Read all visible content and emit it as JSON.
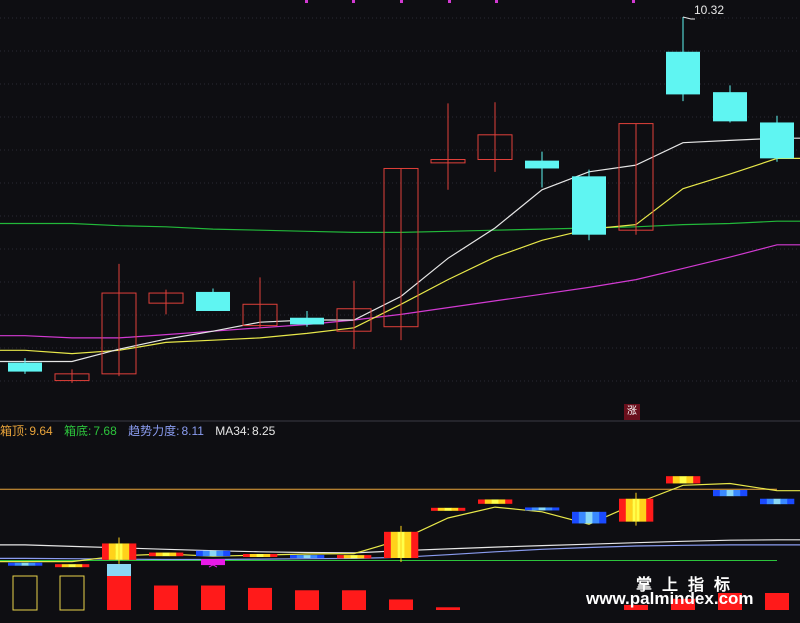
{
  "upper_labels": {
    "high_price": "10.32",
    "zhang_badge": "涨"
  },
  "legend": {
    "box_top_label": "箱顶:",
    "box_top_value": "9.64",
    "box_bottom_label": "箱底:",
    "box_bottom_value": "7.68",
    "trend_label": "趋势力度:",
    "trend_value": "8.11",
    "ma34_label": "MA34:",
    "ma34_value": "8.25"
  },
  "watermark": {
    "line1": "掌上指标",
    "line2": "www.palmindex.com"
  },
  "colors": {
    "background": "#0e0e12",
    "up": "#e0403a",
    "down": "#5ff5f2",
    "ma_white": "#e6e6e6",
    "ma_yellow": "#e8e84a",
    "ma_green": "#22b83a",
    "ma_magenta": "#d23ad2",
    "box_top": "#e8a33a",
    "box_bottom": "#2cc43c",
    "trend": "#8a9cf0",
    "ma34": "#e6e6e6"
  },
  "chart_data": [
    {
      "type": "candlestick",
      "ylim": [
        6.8,
        10.4
      ],
      "candles": [
        {
          "o": 7.24,
          "h": 7.28,
          "l": 7.14,
          "c": 7.16
        },
        {
          "o": 7.08,
          "h": 7.18,
          "l": 7.06,
          "c": 7.14
        },
        {
          "o": 7.14,
          "h": 8.12,
          "l": 7.12,
          "c": 7.86
        },
        {
          "o": 7.77,
          "h": 7.89,
          "l": 7.67,
          "c": 7.86
        },
        {
          "o": 7.87,
          "h": 7.9,
          "l": 7.7,
          "c": 7.7
        },
        {
          "o": 7.57,
          "h": 8.0,
          "l": 7.55,
          "c": 7.76
        },
        {
          "o": 7.64,
          "h": 7.7,
          "l": 7.56,
          "c": 7.58
        },
        {
          "o": 7.52,
          "h": 7.97,
          "l": 7.36,
          "c": 7.72
        },
        {
          "o": 7.56,
          "h": 8.97,
          "l": 7.44,
          "c": 8.97
        },
        {
          "o": 9.02,
          "h": 9.55,
          "l": 8.78,
          "c": 9.05
        },
        {
          "o": 9.05,
          "h": 9.56,
          "l": 8.94,
          "c": 9.27
        },
        {
          "o": 9.04,
          "h": 9.12,
          "l": 8.8,
          "c": 8.97
        },
        {
          "o": 8.9,
          "h": 8.96,
          "l": 8.33,
          "c": 8.38
        },
        {
          "o": 8.42,
          "h": 9.37,
          "l": 8.38,
          "c": 9.37
        },
        {
          "o": 10.01,
          "h": 10.32,
          "l": 9.57,
          "c": 9.63
        },
        {
          "o": 9.65,
          "h": 9.71,
          "l": 9.38,
          "c": 9.39
        },
        {
          "o": 9.38,
          "h": 9.44,
          "l": 9.03,
          "c": 9.06
        }
      ],
      "ma_white": [
        7.25,
        7.25,
        7.36,
        7.45,
        7.52,
        7.6,
        7.62,
        7.62,
        7.83,
        8.17,
        8.44,
        8.78,
        8.94,
        9.0,
        9.2,
        9.22,
        9.24
      ],
      "ma_yellow": [
        7.35,
        7.32,
        7.35,
        7.42,
        7.44,
        7.46,
        7.5,
        7.55,
        7.76,
        7.98,
        8.18,
        8.33,
        8.43,
        8.47,
        8.79,
        8.92,
        9.06
      ],
      "ma_green": [
        8.48,
        8.48,
        8.46,
        8.45,
        8.43,
        8.42,
        8.41,
        8.4,
        8.4,
        8.41,
        8.42,
        8.43,
        8.44,
        8.45,
        8.47,
        8.48,
        8.5
      ],
      "ma_magenta": [
        7.48,
        7.46,
        7.46,
        7.49,
        7.52,
        7.55,
        7.58,
        7.62,
        7.67,
        7.73,
        7.79,
        7.85,
        7.91,
        7.98,
        8.08,
        8.18,
        8.29
      ]
    },
    {
      "type": "indicator",
      "ylim": [
        7.2,
        10.5
      ],
      "box_top": 9.64,
      "box_bottom": 7.68,
      "trend_line": [
        7.65,
        7.65,
        7.81,
        7.86,
        7.8,
        7.83,
        7.86,
        7.87,
        8.25,
        8.85,
        9.15,
        9.02,
        8.68,
        9.25,
        9.75,
        9.8,
        9.6
      ],
      "ma34_line": [
        8.11,
        8.07,
        8.03,
        7.99,
        7.95,
        7.92,
        7.9,
        7.89,
        7.95,
        8.0,
        8.05,
        8.09,
        8.13,
        8.17,
        8.21,
        8.24,
        8.25
      ],
      "trend_strength": [
        7.74,
        7.73,
        7.72,
        7.71,
        7.71,
        7.72,
        7.73,
        7.74,
        7.77,
        7.84,
        7.92,
        7.99,
        8.04,
        8.08,
        8.1,
        8.11,
        8.11
      ],
      "bars": [
        {
          "o": 7.62,
          "c": 7.58,
          "state": "weak-down"
        },
        {
          "o": 7.58,
          "c": 7.55,
          "state": "weak-up"
        },
        {
          "o": 8.15,
          "c": 7.7,
          "state": "strong-up"
        },
        {
          "o": 7.9,
          "c": 7.8,
          "state": "up"
        },
        {
          "o": 7.95,
          "c": 7.8,
          "state": "down"
        },
        {
          "o": 7.86,
          "c": 7.78,
          "state": "up"
        },
        {
          "o": 7.83,
          "c": 7.75,
          "state": "down"
        },
        {
          "o": 7.83,
          "c": 7.74,
          "state": "up"
        },
        {
          "o": 8.47,
          "c": 7.75,
          "state": "strong-up"
        },
        {
          "o": 9.13,
          "c": 9.1,
          "state": "up"
        },
        {
          "o": 9.36,
          "c": 9.24,
          "state": "up"
        },
        {
          "o": 9.14,
          "c": 9.06,
          "state": "down"
        },
        {
          "o": 9.02,
          "c": 8.7,
          "state": "down"
        },
        {
          "o": 9.38,
          "c": 8.75,
          "state": "strong-up"
        },
        {
          "o": 10.0,
          "c": 9.8,
          "state": "up"
        },
        {
          "o": 9.62,
          "c": 9.45,
          "state": "down"
        },
        {
          "o": 9.38,
          "c": 9.23,
          "state": "down"
        }
      ],
      "bottom_blocks": [
        {
          "value": 1.0,
          "kind": "hollow"
        },
        {
          "value": 1.0,
          "kind": "hollow"
        },
        {
          "value": 1.0,
          "kind": "red-with-cyan"
        },
        {
          "value": 0.72,
          "kind": "red"
        },
        {
          "value": 0.72,
          "kind": "red"
        },
        {
          "value": 0.65,
          "kind": "red"
        },
        {
          "value": 0.58,
          "kind": "red"
        },
        {
          "value": 0.58,
          "kind": "red"
        },
        {
          "value": 0.31,
          "kind": "red"
        },
        {
          "value": 0.08,
          "kind": "red"
        },
        {
          "value": 0,
          "kind": "none"
        },
        {
          "value": 0,
          "kind": "none"
        },
        {
          "value": 0,
          "kind": "none"
        },
        {
          "value": 0.15,
          "kind": "red"
        },
        {
          "value": 0.33,
          "kind": "red"
        },
        {
          "value": 0.5,
          "kind": "red"
        },
        {
          "value": 0.5,
          "kind": "red"
        }
      ]
    }
  ]
}
